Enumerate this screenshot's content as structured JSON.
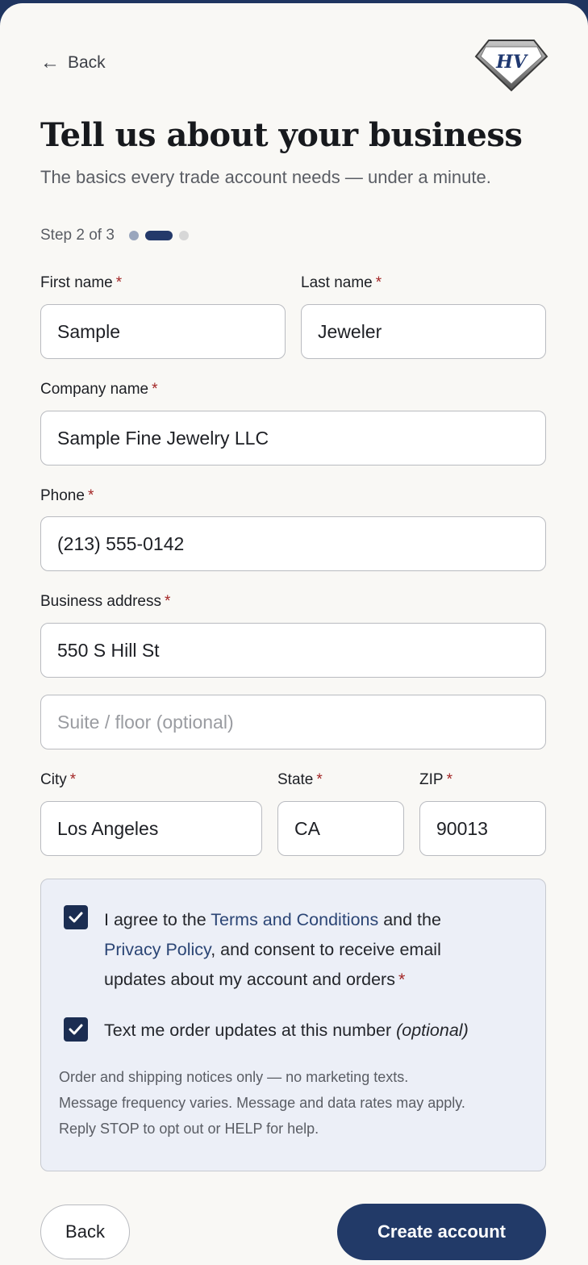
{
  "nav": {
    "back_label": "Back",
    "back_arrow": "←"
  },
  "header": {
    "title": "Tell us about your business",
    "subtitle": "The basics every trade account needs — under a minute."
  },
  "progress": {
    "label": "Step 2 of 3",
    "current": 2,
    "total": 3
  },
  "form": {
    "required_mark": "*",
    "first_name": {
      "label": "First name",
      "value": "Sample"
    },
    "last_name": {
      "label": "Last name",
      "value": "Jeweler"
    },
    "company": {
      "label": "Company name",
      "value": "Sample Fine Jewelry LLC"
    },
    "phone": {
      "label": "Phone",
      "value": "(213) 555-0142"
    },
    "address": {
      "label": "Business address",
      "value": "550 S Hill St"
    },
    "suite": {
      "placeholder": "Suite / floor (optional)",
      "value": ""
    },
    "city": {
      "label": "City",
      "value": "Los Angeles"
    },
    "state": {
      "label": "State",
      "value": "CA"
    },
    "zip": {
      "label": "ZIP",
      "value": "90013"
    }
  },
  "consent": {
    "terms": {
      "checked": true,
      "prefix": "I agree to the ",
      "terms_link": "Terms and Conditions",
      "middle": " and the",
      "privacy_link": "Privacy Policy",
      "suffix_line2": ", and consent to receive email",
      "line3": "updates about my account and orders"
    },
    "sms": {
      "checked": true,
      "label": "Text me order updates at this number ",
      "optional": "(optional)"
    },
    "fineprint": [
      "Order and shipping notices only — no marketing texts.",
      "Message frequency varies. Message and data rates may apply.",
      "Reply STOP to opt out or HELP for help."
    ]
  },
  "actions": {
    "back_label": "Back",
    "create_label": "Create account"
  },
  "colors": {
    "primary": "#223a68",
    "required": "#a32626",
    "background": "#f9f8f5",
    "consent_bg": "#eceff7"
  },
  "logo": {
    "monogram": "HV"
  }
}
